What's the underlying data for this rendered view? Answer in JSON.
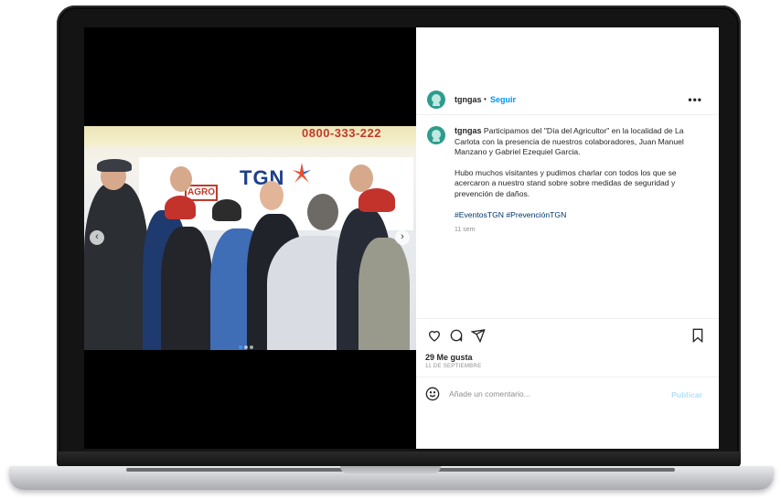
{
  "post": {
    "username": "tgngas",
    "separator": "•",
    "follow_label": "Seguir",
    "more_label": "•••",
    "caption_user": "tgngas",
    "caption_text": "Participamos del \"Día del Agricultor\" en la localidad de La Carlota con la presencia de nuestros colaboradores, Juan Manuel Manzano y Gabriel Ezequiel Garcia.",
    "caption_text2": "Hubo muchos visitantes y pudimos charlar con todos los que se acercaron a nuestro stand sobre sobre medidas de seguridad y prevención de daños.",
    "hashtags": "#EventosTGN #PrevenciónTGN",
    "time_ago": "11 sem",
    "likes": "29 Me gusta",
    "date": "11 DE SEPTIEMBRE",
    "comment_placeholder": "Añade un comentario...",
    "publish_label": "Publicar"
  },
  "photo": {
    "tent_text": "0800-333-222",
    "logo_text": "TGN",
    "badge_text": "AGRO",
    "carousel_pages": 3,
    "carousel_active": 1
  },
  "icons": {
    "like": "heart-icon",
    "comment": "comment-icon",
    "share": "send-icon",
    "save": "bookmark-icon",
    "emoji": "emoji-icon"
  },
  "colors": {
    "accent": "#0095f6",
    "publish_disabled": "#b2dffc",
    "avatar": "#2e9c8d"
  }
}
